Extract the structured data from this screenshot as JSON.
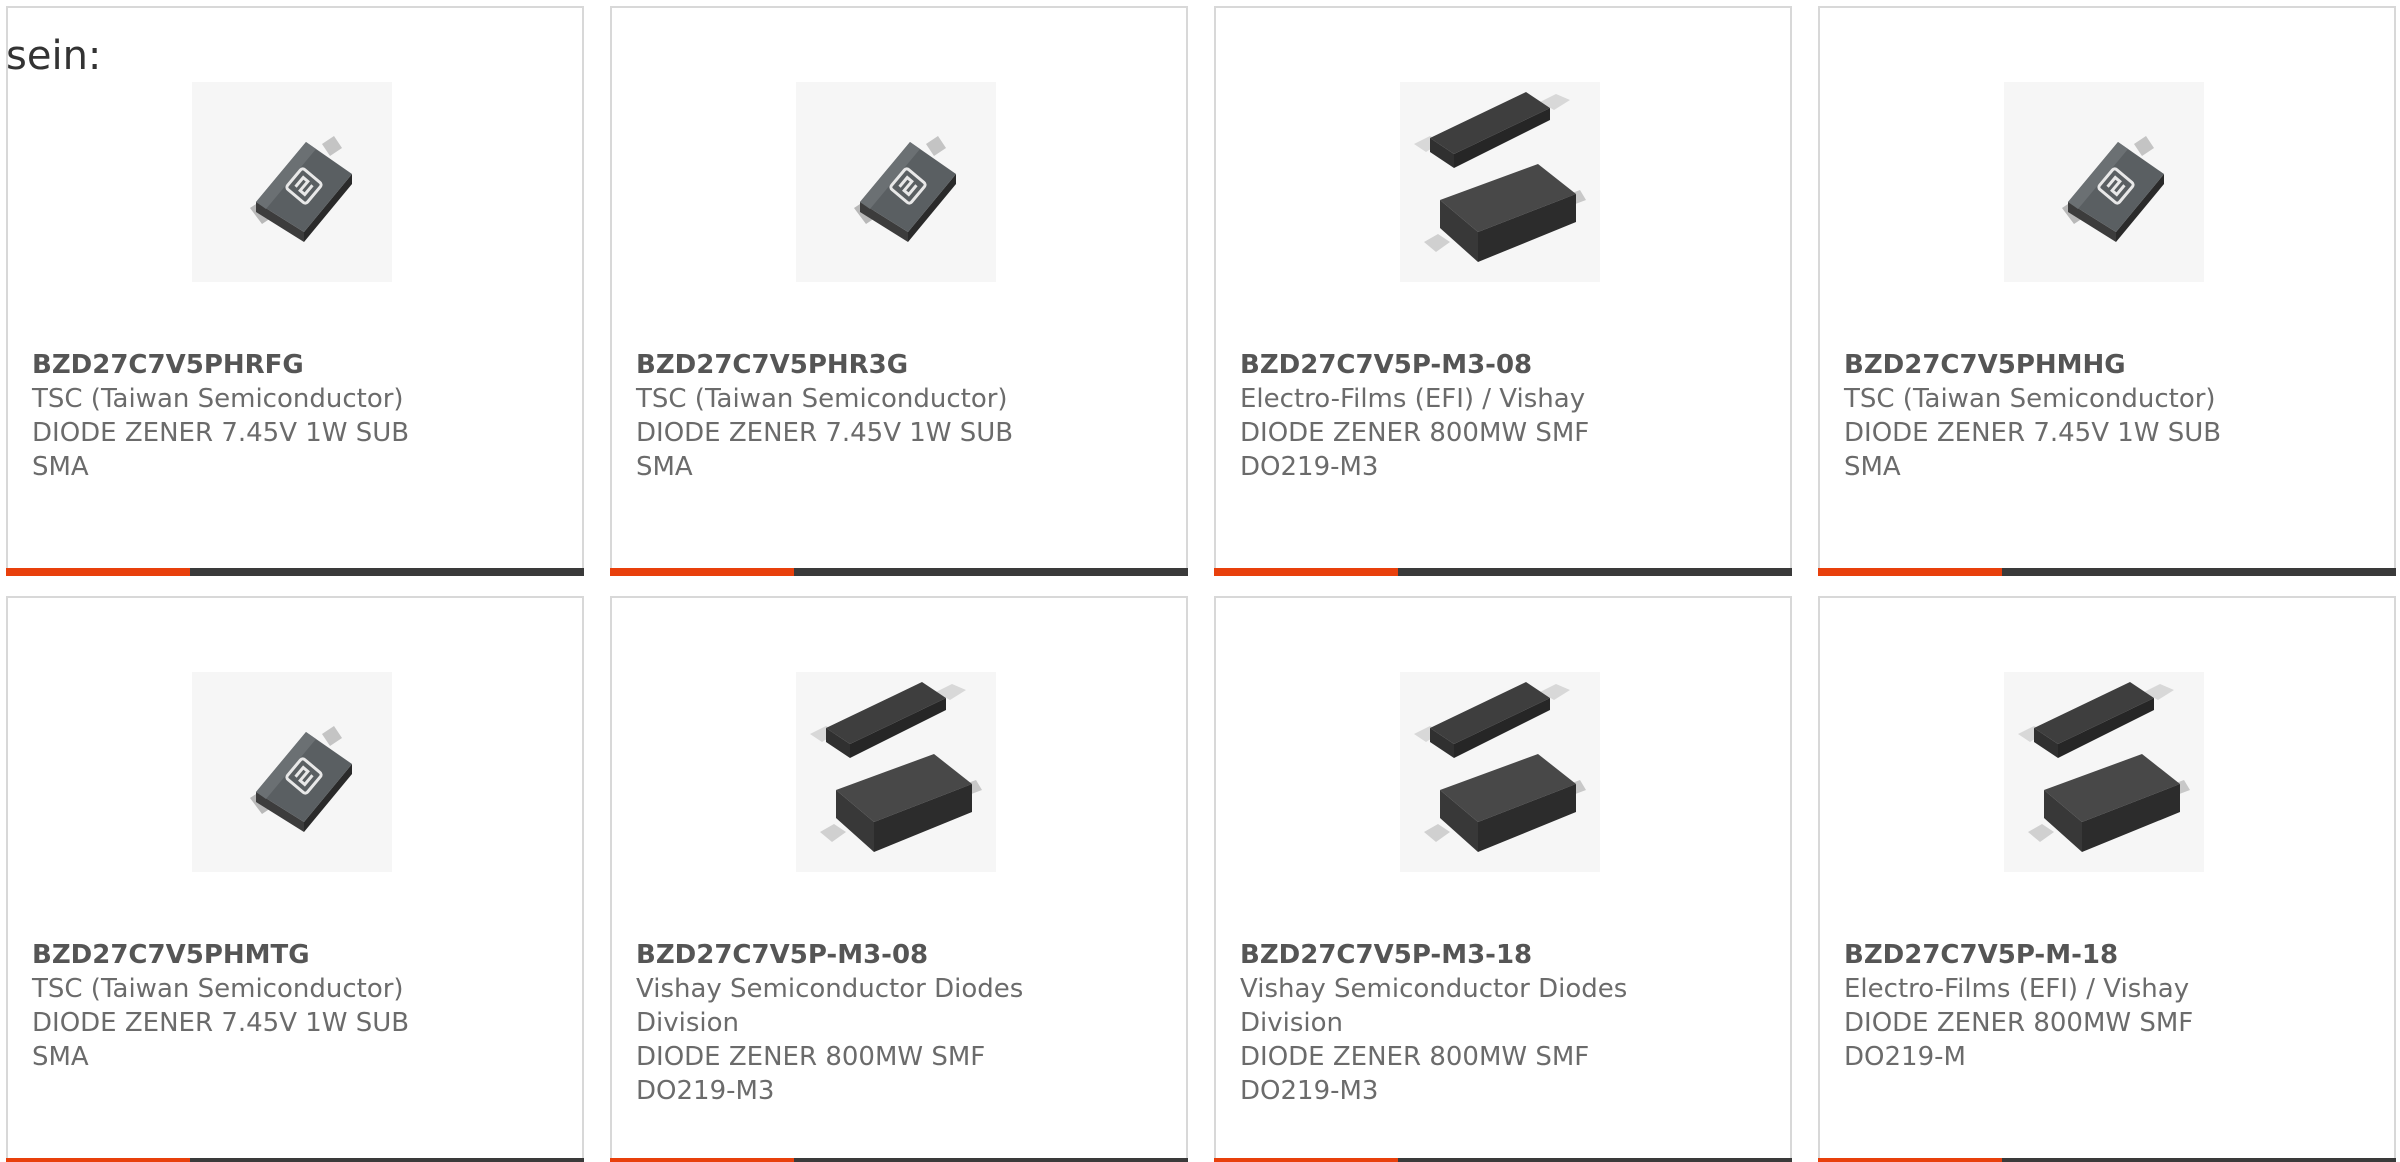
{
  "intro_text": "sein:",
  "colors": {
    "accent": "#e8400c",
    "bar": "#3a3a3a",
    "border": "#d8d8d8"
  },
  "products": [
    {
      "part": "BZD27C7V5PHRFG",
      "manufacturer": "TSC (Taiwan Semiconductor)",
      "desc1": "DIODE ZENER 7.45V 1W SUB",
      "desc2": "SMA",
      "image": "sma-diode-package-icon"
    },
    {
      "part": "BZD27C7V5PHR3G",
      "manufacturer": "TSC (Taiwan Semiconductor)",
      "desc1": "DIODE ZENER 7.45V 1W SUB",
      "desc2": "SMA",
      "image": "sma-diode-package-icon"
    },
    {
      "part": "BZD27C7V5P-M3-08",
      "manufacturer": "Electro-Films (EFI) / Vishay",
      "desc1": "DIODE ZENER 800MW SMF",
      "desc2": "DO219-M3",
      "image": "smf-diode-package-icon"
    },
    {
      "part": "BZD27C7V5PHMHG",
      "manufacturer": "TSC (Taiwan Semiconductor)",
      "desc1": "DIODE ZENER 7.45V 1W SUB",
      "desc2": "SMA",
      "image": "sma-diode-package-icon"
    },
    {
      "part": "BZD27C7V5PHMTG",
      "manufacturer": "TSC (Taiwan Semiconductor)",
      "desc1": "DIODE ZENER 7.45V 1W SUB",
      "desc2": "SMA",
      "image": "sma-diode-package-icon"
    },
    {
      "part": "BZD27C7V5P-M3-08",
      "manufacturer": "Vishay Semiconductor Diodes Division",
      "desc1": "DIODE ZENER 800MW SMF",
      "desc2": "DO219-M3",
      "image": "smf-diode-package-icon"
    },
    {
      "part": "BZD27C7V5P-M3-18",
      "manufacturer": "Vishay Semiconductor Diodes Division",
      "desc1": "DIODE ZENER 800MW SMF",
      "desc2": "DO219-M3",
      "image": "smf-diode-package-icon"
    },
    {
      "part": "BZD27C7V5P-M-18",
      "manufacturer": "Electro-Films (EFI) / Vishay",
      "desc1": "DIODE ZENER 800MW SMF",
      "desc2": "DO219-M",
      "image": "smf-diode-package-icon"
    }
  ]
}
